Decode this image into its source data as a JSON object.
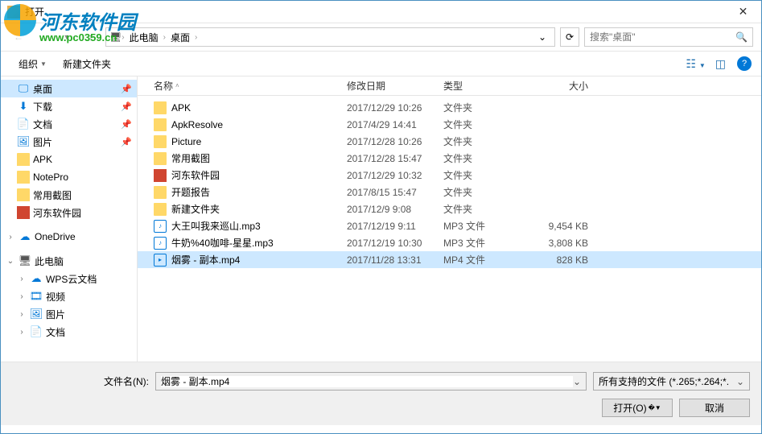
{
  "window": {
    "title": "打开"
  },
  "watermark": {
    "text": "河东软件园",
    "url": "www.pc0359.cn"
  },
  "breadcrumb": {
    "segments": [
      "此电脑",
      "桌面"
    ]
  },
  "search": {
    "placeholder": "搜索\"桌面\""
  },
  "toolbar": {
    "organize": "组织",
    "newfolder": "新建文件夹"
  },
  "sidebar": {
    "items": [
      {
        "label": "桌面",
        "icon": "desktop",
        "pinned": true,
        "active": true,
        "indent": 1
      },
      {
        "label": "下载",
        "icon": "download",
        "pinned": true,
        "indent": 1
      },
      {
        "label": "文档",
        "icon": "doc",
        "pinned": true,
        "indent": 1
      },
      {
        "label": "图片",
        "icon": "pic",
        "pinned": true,
        "indent": 1
      },
      {
        "label": "APK",
        "icon": "folder",
        "indent": 1
      },
      {
        "label": "NotePro",
        "icon": "folder",
        "indent": 1
      },
      {
        "label": "常用截图",
        "icon": "folder",
        "indent": 1
      },
      {
        "label": "河东软件园",
        "icon": "folder-red",
        "indent": 1
      }
    ],
    "onedrive": {
      "label": "OneDrive"
    },
    "thispc": {
      "label": "此电脑",
      "children": [
        {
          "label": "WPS云文档",
          "icon": "cloud"
        },
        {
          "label": "视频",
          "icon": "video"
        },
        {
          "label": "图片",
          "icon": "pic"
        },
        {
          "label": "文档",
          "icon": "doc"
        }
      ]
    }
  },
  "columns": {
    "name": "名称",
    "date": "修改日期",
    "type": "类型",
    "size": "大小"
  },
  "files": [
    {
      "name": "APK",
      "date": "2017/12/29 10:26",
      "type": "文件夹",
      "size": "",
      "icon": "fold"
    },
    {
      "name": "ApkResolve",
      "date": "2017/4/29 14:41",
      "type": "文件夹",
      "size": "",
      "icon": "fold"
    },
    {
      "name": "Picture",
      "date": "2017/12/28 10:26",
      "type": "文件夹",
      "size": "",
      "icon": "fold"
    },
    {
      "name": "常用截图",
      "date": "2017/12/28 15:47",
      "type": "文件夹",
      "size": "",
      "icon": "fold"
    },
    {
      "name": "河东软件园",
      "date": "2017/12/29 10:32",
      "type": "文件夹",
      "size": "",
      "icon": "fold-red"
    },
    {
      "name": "开题报告",
      "date": "2017/8/15 15:47",
      "type": "文件夹",
      "size": "",
      "icon": "fold"
    },
    {
      "name": "新建文件夹",
      "date": "2017/12/9 9:08",
      "type": "文件夹",
      "size": "",
      "icon": "fold"
    },
    {
      "name": "大王叫我来巡山.mp3",
      "date": "2017/12/19 9:11",
      "type": "MP3 文件",
      "size": "9,454 KB",
      "icon": "audio"
    },
    {
      "name": "牛奶%40咖啡-星星.mp3",
      "date": "2017/12/19 10:30",
      "type": "MP3 文件",
      "size": "3,808 KB",
      "icon": "audio"
    },
    {
      "name": "烟雾 - 副本.mp4",
      "date": "2017/11/28 13:31",
      "type": "MP4 文件",
      "size": "828 KB",
      "icon": "vid",
      "selected": true
    }
  ],
  "footer": {
    "filename_label": "文件名(N):",
    "filename_value": "烟雾 - 副本.mp4",
    "filetype": "所有支持的文件 (*.265;*.264;*.",
    "open": "打开(O)",
    "cancel": "取消"
  }
}
